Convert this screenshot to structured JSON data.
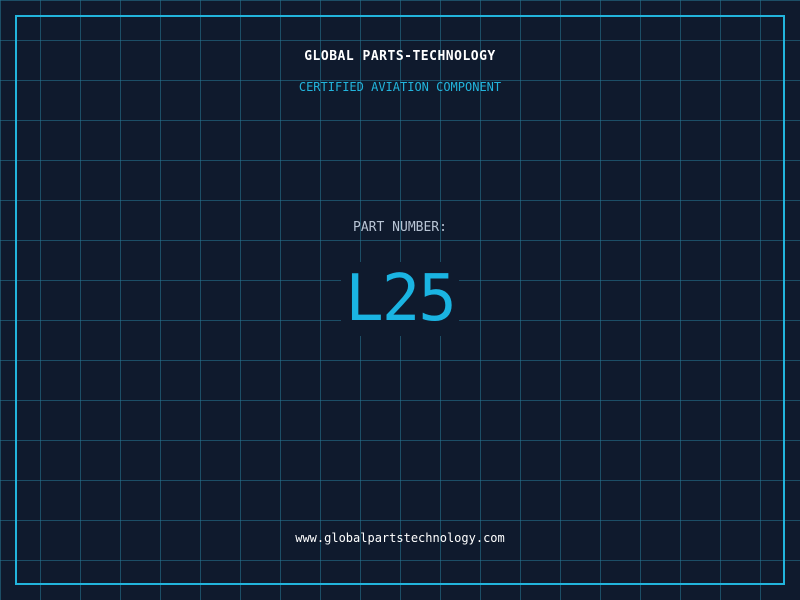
{
  "label": {
    "company": "GLOBAL PARTS-TECHNOLOGY",
    "certification": "CERTIFIED AVIATION COMPONENT",
    "part_number_label": "PART NUMBER:",
    "part_number": "L25",
    "website": "www.globalpartstechnology.com"
  },
  "colors": {
    "background": "#0f1a2d",
    "grid": "#26788f",
    "accent": "#22b4dc",
    "text_primary": "#ffffff",
    "text_secondary": "#b8c4d4"
  }
}
